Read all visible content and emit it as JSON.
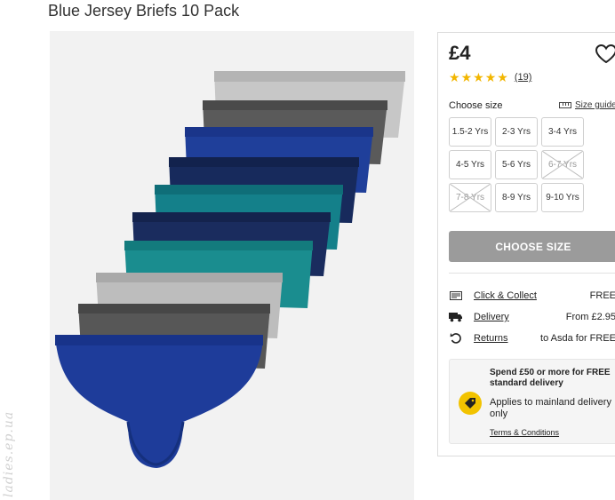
{
  "product": {
    "title": "Blue Jersey Briefs 10 Pack",
    "price": "£4",
    "rating_value": 5,
    "rating_max": 5,
    "review_count": "(19)"
  },
  "size_selector": {
    "label": "Choose size",
    "guide_label": "Size guide",
    "options": [
      {
        "label": "1.5-2 Yrs",
        "available": true
      },
      {
        "label": "2-3 Yrs",
        "available": true
      },
      {
        "label": "3-4 Yrs",
        "available": true
      },
      {
        "label": "4-5 Yrs",
        "available": true
      },
      {
        "label": "5-6 Yrs",
        "available": true
      },
      {
        "label": "6-7 Yrs",
        "available": false
      },
      {
        "label": "7-8 Yrs",
        "available": false
      },
      {
        "label": "8-9 Yrs",
        "available": true
      },
      {
        "label": "9-10 Yrs",
        "available": true
      }
    ]
  },
  "cta": {
    "label": "CHOOSE SIZE",
    "color": "#9b9b9b"
  },
  "delivery": {
    "click_collect": {
      "label": "Click & Collect",
      "value": "FREE",
      "icon": "store-icon"
    },
    "delivery": {
      "label": "Delivery",
      "value": "From £2.95",
      "icon": "van-icon"
    },
    "returns": {
      "label": "Returns",
      "value": "to Asda for FREE",
      "icon": "returns-icon"
    }
  },
  "promo": {
    "headline": "Spend £50 or more for FREE standard delivery",
    "note": "Applies to mainland delivery only",
    "terms_link": "Terms & Conditions",
    "badge_color": "#f2c300",
    "icon": "tag-icon"
  },
  "watermark": "ladies.ep.ua",
  "colors": {
    "star": "#f2b600",
    "panel_border": "#dcdcdc"
  }
}
